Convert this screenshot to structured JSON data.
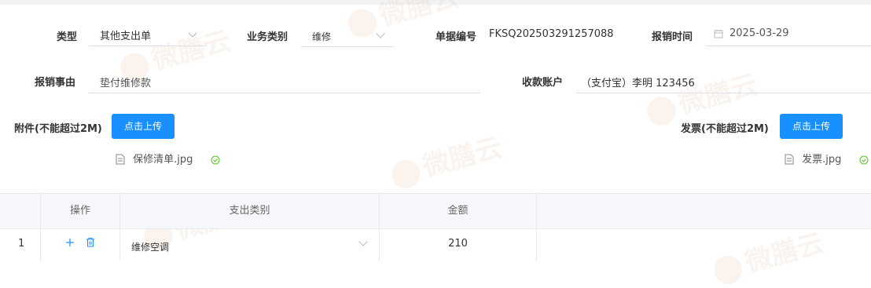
{
  "form": {
    "type_label": "类型",
    "type_value": "其他支出单",
    "category_label": "业务类别",
    "category_value": "维修",
    "doc_no_label": "单据编号",
    "doc_no_value": "FKSQ202503291257088",
    "date_label": "报销时间",
    "date_value": "2025-03-29",
    "reason_label": "报销事由",
    "reason_value": "垫付维修款",
    "account_label": "收款账户",
    "account_value": "（支付宝）李明 123456"
  },
  "attachments": {
    "label": "附件(不能超过2M)",
    "upload_label": "点击上传",
    "files": [
      "保修清单.jpg"
    ]
  },
  "invoices": {
    "label": "发票(不能超过2M)",
    "upload_label": "点击上传",
    "files": [
      "发票.jpg"
    ]
  },
  "table": {
    "headers": [
      "操作",
      "支出类别",
      "金额"
    ],
    "rows": [
      {
        "index": "1",
        "category": "维修空调",
        "amount": "210"
      }
    ]
  },
  "watermark": "微膳云",
  "colors": {
    "primary": "#1890ff",
    "success": "#52c41a"
  }
}
